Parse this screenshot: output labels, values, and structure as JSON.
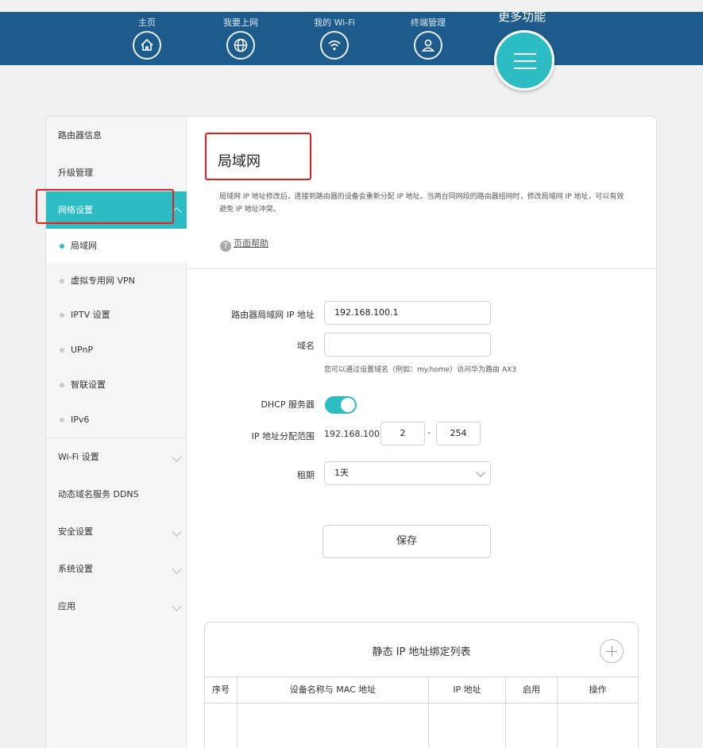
{
  "nav": {
    "items": [
      {
        "label": "主页",
        "icon": "home-icon"
      },
      {
        "label": "我要上网",
        "icon": "globe-icon"
      },
      {
        "label": "我的 Wi-Fi",
        "icon": "wifi-icon"
      },
      {
        "label": "终端管理",
        "icon": "user-icon"
      }
    ],
    "more_label": "更多功能",
    "accent": "#2cbcc4",
    "bar_color": "#1d5b8c"
  },
  "sidebar": {
    "items": [
      {
        "label": "路由器信息"
      },
      {
        "label": "升级管理"
      },
      {
        "label": "网络设置"
      },
      {
        "label": "Wi-Fi 设置"
      },
      {
        "label": "动态域名服务 DDNS"
      },
      {
        "label": "安全设置"
      },
      {
        "label": "系统设置"
      },
      {
        "label": "应用"
      }
    ],
    "subitems": [
      {
        "label": "局域网"
      },
      {
        "label": "虚拟专用网 VPN"
      },
      {
        "label": "IPTV 设置"
      },
      {
        "label": "UPnP"
      },
      {
        "label": "智联设置"
      },
      {
        "label": "IPv6"
      }
    ]
  },
  "main": {
    "title": "局域网",
    "description": "局域网 IP 地址修改后，连接到路由器的设备会重新分配 IP 地址。当两台同网段的路由器组网时，修改局域网 IP 地址，可以有效避免 IP 地址冲突。",
    "help_label": "页面帮助",
    "form": {
      "lan_ip_label": "路由器局域网 IP 地址",
      "lan_ip_value": "192.168.100.1",
      "domain_label": "域名",
      "domain_value": "",
      "domain_hint": "您可以通过设置域名（例如：my.home）访问华为路由 AX3",
      "dhcp_label": "DHCP 服务器",
      "dhcp_enabled": true,
      "range_label": "IP 地址分配范围",
      "range_prefix": "192.168.100.",
      "range_start": "2",
      "range_sep": "-",
      "range_end": "254",
      "lease_label": "租期",
      "lease_value": "1天"
    },
    "save_label": "保存",
    "static_table": {
      "title": "静态 IP 地址绑定列表",
      "headers": [
        "序号",
        "设备名称与 MAC 地址",
        "IP 地址",
        "启用",
        "操作"
      ]
    }
  }
}
